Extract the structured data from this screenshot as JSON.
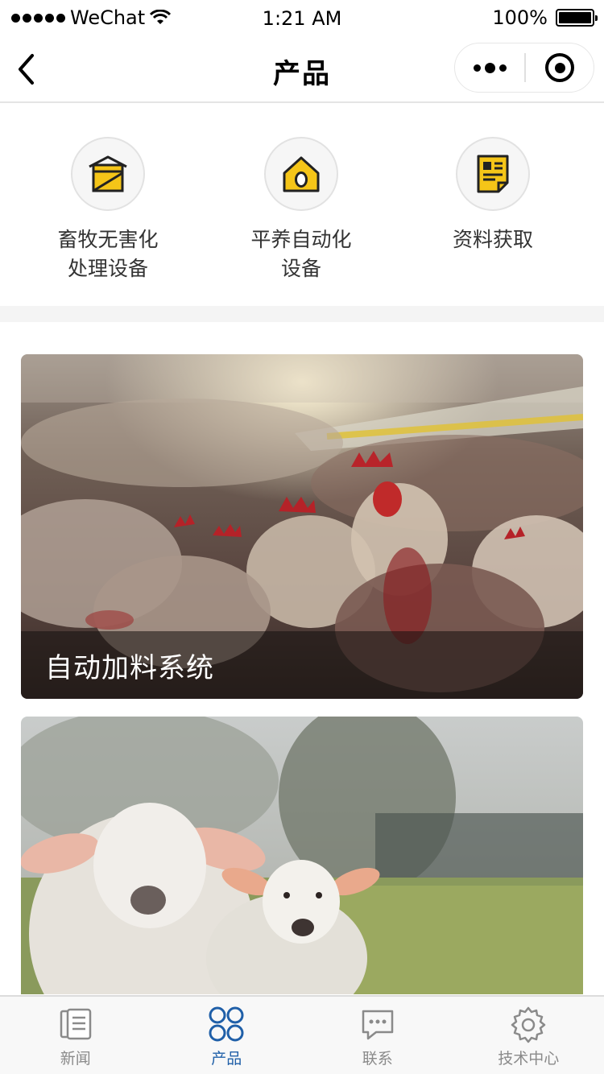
{
  "status_bar": {
    "carrier": "WeChat",
    "time": "1:21 AM",
    "battery": "100%",
    "battery_level": 1.0
  },
  "nav": {
    "title": "产品"
  },
  "categories": [
    {
      "label": "畜牧无害化\n处理设备",
      "icon": "livestock-shed-icon"
    },
    {
      "label": "平养自动化\n设备",
      "icon": "egg-house-icon"
    },
    {
      "label": "资料获取",
      "icon": "document-icon"
    }
  ],
  "cards": [
    {
      "caption": "自动加料系统",
      "image": "chicken-farm-photo"
    },
    {
      "caption": "",
      "image": "lambs-in-field-photo"
    }
  ],
  "tabs": [
    {
      "label": "新闻",
      "icon": "news-icon",
      "active": false
    },
    {
      "label": "产品",
      "icon": "products-icon",
      "active": true
    },
    {
      "label": "联系",
      "icon": "chat-icon",
      "active": false
    },
    {
      "label": "技术中心",
      "icon": "gear-icon",
      "active": false
    }
  ],
  "colors": {
    "accent": "#1f5fa8",
    "icon_yellow": "#f5c518",
    "tab_inactive": "#8a8a8a"
  }
}
